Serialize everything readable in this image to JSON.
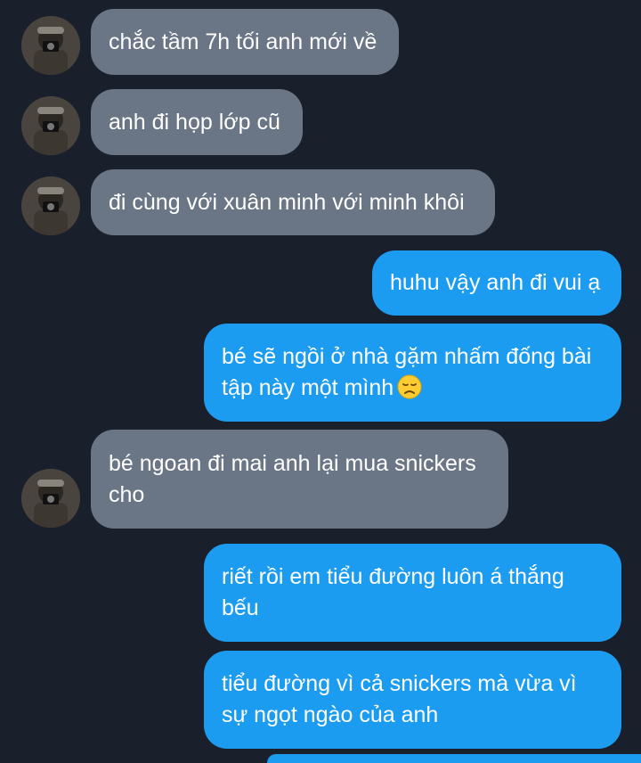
{
  "conversation": {
    "messages": [
      {
        "direction": "incoming",
        "text": "chắc tầm 7h tối anh mới về"
      },
      {
        "direction": "incoming",
        "text": "anh đi họp lớp cũ"
      },
      {
        "direction": "incoming",
        "text": "đi cùng với xuân minh với minh khôi"
      },
      {
        "direction": "outgoing",
        "text": "huhu vậy anh đi vui ạ"
      },
      {
        "direction": "outgoing",
        "text": "bé sẽ ngồi ở nhà gặm nhấm đống bài tập này một mình",
        "emoji": "disappointed-face"
      },
      {
        "direction": "incoming",
        "text": "bé ngoan đi mai anh lại mua snickers cho"
      },
      {
        "direction": "outgoing",
        "text": "riết rồi em tiểu đường luôn á thắng bếu"
      },
      {
        "direction": "outgoing",
        "text": "tiểu đường vì cả snickers mà vừa vì sự ngọt ngào của anh"
      }
    ]
  },
  "colors": {
    "background": "#1a202b",
    "incoming_bubble": "#6a7585",
    "outgoing_bubble": "#1c9cf0",
    "text": "#ffffff"
  },
  "icons": {
    "avatar": "avatar-icon",
    "emoji": "disappointed-face-emoji-icon"
  }
}
